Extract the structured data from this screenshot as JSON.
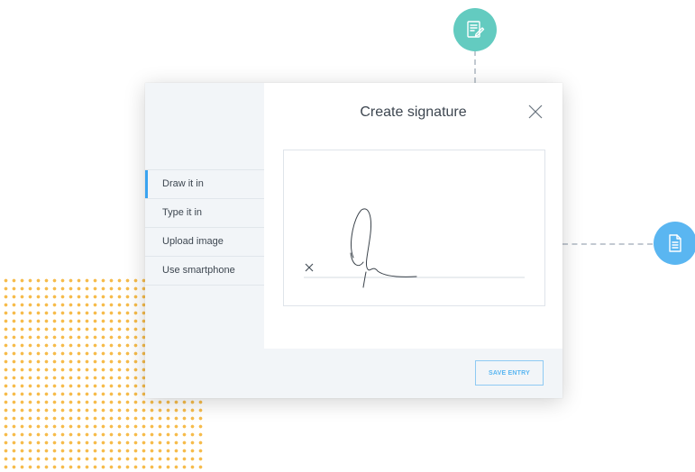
{
  "dialog": {
    "title": "Create signature",
    "save_label": "SAVE ENTRY"
  },
  "sidebar": {
    "items": [
      {
        "label": "Draw it in",
        "active": true
      },
      {
        "label": "Type it in",
        "active": false
      },
      {
        "label": "Upload image",
        "active": false
      },
      {
        "label": "Use smartphone",
        "active": false
      }
    ]
  },
  "signature_pad": {
    "marker": "×"
  },
  "icons": {
    "top": "contract-edit-icon",
    "right": "document-icon",
    "close": "close-icon"
  },
  "colors": {
    "accent": "#3aa3f0",
    "teal": "#63cbc0",
    "blue": "#5ab6f1",
    "dots": "#f6bb4a"
  }
}
